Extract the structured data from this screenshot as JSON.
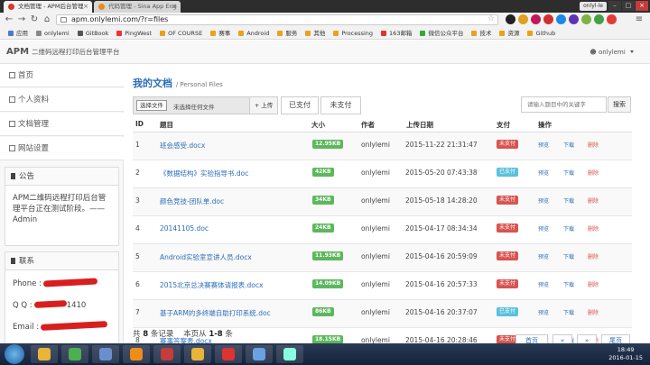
{
  "browser": {
    "tabs": [
      {
        "title": "文档管理 - APM后台管理",
        "active": true,
        "fav_color": "#d33"
      },
      {
        "title": "代码管理 - Sina App Eng",
        "active": false,
        "fav_color": "#e88a1a"
      }
    ],
    "user": "onlyl-le",
    "url": "apm.onlylemi.com/?r=files",
    "bookmarks": [
      {
        "label": "应用",
        "color": "#4a7bd0"
      },
      {
        "label": "onlylemi",
        "color": "#888"
      },
      {
        "label": "GitBook",
        "color": "#555"
      },
      {
        "label": "PingWest",
        "color": "#e33"
      },
      {
        "label": "OF COURSE",
        "color": "#e9a21b"
      },
      {
        "label": "赛事",
        "color": "#e9a21b"
      },
      {
        "label": "Android",
        "color": "#e9a21b"
      },
      {
        "label": "服务",
        "color": "#e9a21b"
      },
      {
        "label": "其他",
        "color": "#e9a21b"
      },
      {
        "label": "Processing",
        "color": "#e9a21b"
      },
      {
        "label": "163邮箱",
        "color": "#d33"
      },
      {
        "label": "微信公众平台",
        "color": "#3a3"
      },
      {
        "label": "技术",
        "color": "#e9a21b"
      },
      {
        "label": "资源",
        "color": "#e9a21b"
      },
      {
        "label": "Github",
        "color": "#e9a21b"
      }
    ]
  },
  "site": {
    "brand": "APM",
    "brand_sub": "二维码远程打印后台管理平台",
    "user": "onlylemi"
  },
  "sidebar": {
    "items": [
      {
        "label": "首页"
      },
      {
        "label": "个人资料"
      },
      {
        "label": "文档管理"
      },
      {
        "label": "网站设置"
      }
    ],
    "notice_title": "公告",
    "notice_text": "APM二维码远程打印后台管理平台正在测试阶段。——Admin",
    "contact_title": "联系",
    "contact": [
      {
        "label": "Phone :"
      },
      {
        "label": "Q Q :",
        "suffix": "1410"
      },
      {
        "label": "Email :"
      }
    ]
  },
  "main": {
    "title": "我的文档",
    "subtitle": "/ Personal Files",
    "choose_file": "选择文件",
    "no_file": "未选择任何文件",
    "upload": "+ 上传",
    "filter_paid": "已支付",
    "filter_unpaid": "未支付",
    "search_placeholder": "请输入题目中的关键字",
    "search_btn": "搜索",
    "headers": {
      "id": "ID",
      "title": "题目",
      "size": "大小",
      "author": "作者",
      "date": "上传日期",
      "pay": "支付",
      "ops": "操作"
    },
    "actions": {
      "preview": "预览",
      "download": "下载",
      "delete": "删除"
    },
    "rows": [
      {
        "id": "1",
        "title": "班会感受.docx",
        "size": "12.95KB",
        "author": "onlylemi",
        "date": "2015-11-22 21:31:47",
        "pay": "未支付",
        "paid": false
      },
      {
        "id": "2",
        "title": "《数据结构》实验指导书.doc",
        "size": "42KB",
        "author": "onlylemi",
        "date": "2015-05-20 07:43:38",
        "pay": "已支付",
        "paid": true
      },
      {
        "id": "3",
        "title": "颜色竞技-团队单.doc",
        "size": "34KB",
        "author": "onlylemi",
        "date": "2015-05-18 14:28:20",
        "pay": "未支付",
        "paid": false
      },
      {
        "id": "4",
        "title": "20141105.doc",
        "size": "24KB",
        "author": "onlylemi",
        "date": "2015-04-17 08:34:34",
        "pay": "未支付",
        "paid": false
      },
      {
        "id": "5",
        "title": "Android实验室宣讲人员.docx",
        "size": "11.93KB",
        "author": "onlylemi",
        "date": "2015-04-16 20:59:09",
        "pay": "未支付",
        "paid": false
      },
      {
        "id": "6",
        "title": "2015北京总决赛赛体请报表.docx",
        "size": "14.09KB",
        "author": "onlylemi",
        "date": "2015-04-16 20:57:33",
        "pay": "未支付",
        "paid": false
      },
      {
        "id": "7",
        "title": "基于ARM的多终端自助打印系统.doc",
        "size": "86KB",
        "author": "onlylemi",
        "date": "2015-04-16 20:37:07",
        "pay": "已支付",
        "paid": true
      },
      {
        "id": "8",
        "title": "赛事答案表.docx",
        "size": "18.15KB",
        "author": "onlylemi",
        "date": "2015-04-16 20:28:46",
        "pay": "未支付",
        "paid": false
      }
    ],
    "summary_pre": "共",
    "summary_total": "8",
    "summary_mid": "条记录    本页从",
    "summary_range": "1-8",
    "summary_post": "条",
    "pager": {
      "first": "首页",
      "prev": "«",
      "next": "»",
      "last": "尾页"
    }
  },
  "taskbar": {
    "apps": [
      {
        "name": "explorer",
        "color": "#e8b53a"
      },
      {
        "name": "chrome",
        "color": "#4caf50"
      },
      {
        "name": "notes",
        "color": "#6a8fd0"
      },
      {
        "name": "sublime",
        "color": "#f08c1a"
      },
      {
        "name": "app5",
        "color": "#c43c3c"
      },
      {
        "name": "app6",
        "color": "#e8b53a"
      },
      {
        "name": "app7",
        "color": "#d33"
      },
      {
        "name": "app8",
        "color": "#6aa1e0"
      },
      {
        "name": "app9",
        "color": "#8fd"
      }
    ],
    "time": "18:49",
    "date": "2016-01-15"
  }
}
